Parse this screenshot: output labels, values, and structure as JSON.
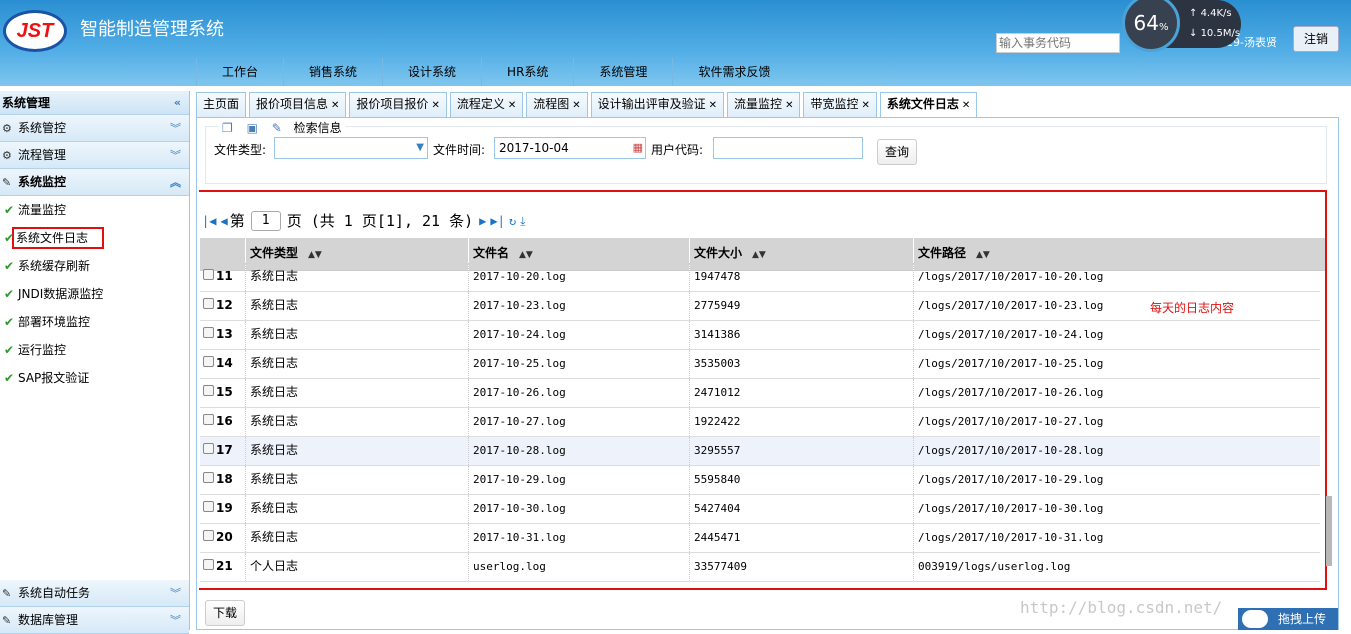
{
  "app": {
    "title": "智能制造管理系统",
    "logo_text": "JST"
  },
  "nav": [
    "工作台",
    "销售系统",
    "设计系统",
    "HR系统",
    "系统管理",
    "软件需求反馈"
  ],
  "header": {
    "search_placeholder": "输入事务代码",
    "user_text": "19-汤表贤",
    "logout": "注销",
    "cpu_percent": "64",
    "cpu_unit": "%",
    "upload_speed": "4.4K/s",
    "download_speed": "10.5M/s"
  },
  "sidebar": {
    "title": "系统管理",
    "groups": {
      "g1": "系统管控",
      "g2": "流程管理",
      "g3": "系统监控",
      "g4": "系统自动任务",
      "g5": "数据库管理"
    },
    "items": [
      "流量监控",
      "系统文件日志",
      "系统缓存刷新",
      "JNDI数据源监控",
      "部署环境监控",
      "运行监控",
      "SAP报文验证"
    ]
  },
  "tabs": [
    "主页面",
    "报价项目信息",
    "报价项目报价",
    "流程定义",
    "流程图",
    "设计输出评审及验证",
    "流量监控",
    "带宽监控",
    "系统文件日志"
  ],
  "filter": {
    "panel_title": "检索信息",
    "file_type_label": "文件类型:",
    "file_type_value": "",
    "file_time_label": "文件时间:",
    "file_time_value": "2017-10-04",
    "user_code_label": "用户代码:",
    "user_code_value": "",
    "query_button": "查询"
  },
  "pager": {
    "prefix": "第",
    "page": "1",
    "suffix": "页 (共 1 页[1], 21 条)"
  },
  "grid": {
    "headers": [
      "文件类型",
      "文件名",
      "文件大小",
      "文件路径"
    ],
    "rows": [
      {
        "n": "11",
        "type": "系统日志",
        "name": "2017-10-20.log",
        "size": "1947478",
        "path": "/logs/2017/10/2017-10-20.log"
      },
      {
        "n": "12",
        "type": "系统日志",
        "name": "2017-10-23.log",
        "size": "2775949",
        "path": "/logs/2017/10/2017-10-23.log"
      },
      {
        "n": "13",
        "type": "系统日志",
        "name": "2017-10-24.log",
        "size": "3141386",
        "path": "/logs/2017/10/2017-10-24.log"
      },
      {
        "n": "14",
        "type": "系统日志",
        "name": "2017-10-25.log",
        "size": "3535003",
        "path": "/logs/2017/10/2017-10-25.log"
      },
      {
        "n": "15",
        "type": "系统日志",
        "name": "2017-10-26.log",
        "size": "2471012",
        "path": "/logs/2017/10/2017-10-26.log"
      },
      {
        "n": "16",
        "type": "系统日志",
        "name": "2017-10-27.log",
        "size": "1922422",
        "path": "/logs/2017/10/2017-10-27.log"
      },
      {
        "n": "17",
        "type": "系统日志",
        "name": "2017-10-28.log",
        "size": "3295557",
        "path": "/logs/2017/10/2017-10-28.log"
      },
      {
        "n": "18",
        "type": "系统日志",
        "name": "2017-10-29.log",
        "size": "5595840",
        "path": "/logs/2017/10/2017-10-29.log"
      },
      {
        "n": "19",
        "type": "系统日志",
        "name": "2017-10-30.log",
        "size": "5427404",
        "path": "/logs/2017/10/2017-10-30.log"
      },
      {
        "n": "20",
        "type": "系统日志",
        "name": "2017-10-31.log",
        "size": "2445471",
        "path": "/logs/2017/10/2017-10-31.log"
      },
      {
        "n": "21",
        "type": "个人日志",
        "name": "userlog.log",
        "size": "33577409",
        "path": "003919/logs/userlog.log"
      }
    ]
  },
  "annotation": "每天的日志内容",
  "download_button": "下载",
  "watermark": "http://blog.csdn.net/",
  "upload_button": "拖拽上传",
  "colors": {
    "accent": "#2a8fd2",
    "highlight": "#e01010"
  }
}
